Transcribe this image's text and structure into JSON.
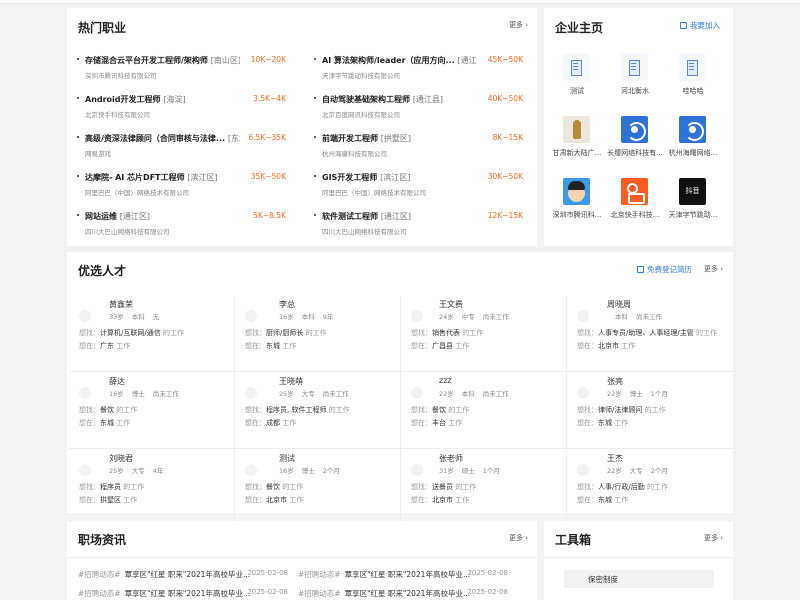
{
  "hot_jobs": {
    "title": "热门职业",
    "more": "更多",
    "items": [
      {
        "title": "存储混合云平台开发工程师/架构师",
        "area": "[南山区]",
        "salary": "10K~20K",
        "company": "深圳市腾讯科技有限公司"
      },
      {
        "title": "AI 算法架构师/leader（应用方向...",
        "area": "[通江县]",
        "salary": "45K~50K",
        "company": "天津字节跳动科技有限公司"
      },
      {
        "title": "Android开发工程师",
        "area": "[海淀]",
        "salary": "3.5K~4K",
        "company": "北京快手科技有限公司"
      },
      {
        "title": "自动驾驶基础架构工程师",
        "area": "[通江县]",
        "salary": "40K~50K",
        "company": "北京百度网讯科技有限公司"
      },
      {
        "title": "高级/资深法律顾问（合同审核与法律...",
        "area": "[东城]",
        "salary": "6.5K~35K",
        "company": "网易游戏"
      },
      {
        "title": "前端开发工程师",
        "area": "[拱墅区]",
        "salary": "8K~15K",
        "company": "杭州海康科技有限公司"
      },
      {
        "title": "达摩院- AI 芯片DFT工程师",
        "area": "[滨江区]",
        "salary": "35K~50K",
        "company": "阿里巴巴（中国）网络技术有限公司"
      },
      {
        "title": "GIS开发工程师",
        "area": "[滨江区]",
        "salary": "30K~50K",
        "company": "阿里巴巴（中国）网络技术有限公司"
      },
      {
        "title": "网站运维",
        "area": "[通江区]",
        "salary": "5K~8.5K",
        "company": "四川大巴山网络科技有限公司"
      },
      {
        "title": "软件测试工程师",
        "area": "[通江区]",
        "salary": "12K~15K",
        "company": "四川大巴山网络科技有限公司"
      }
    ]
  },
  "companies": {
    "title": "企业主页",
    "join": "我要加入",
    "items": [
      {
        "name": "测试",
        "logo": "building-icon"
      },
      {
        "name": "河北衡水",
        "logo": "building-icon"
      },
      {
        "name": "哇哈哈",
        "logo": "building-icon"
      },
      {
        "name": "甘肃新大陆广...",
        "logo": "sculpture-logo"
      },
      {
        "name": "长缨网络科技有...",
        "logo": "bird-logo"
      },
      {
        "name": "杭州海曙网络...",
        "logo": "bird-logo"
      },
      {
        "name": "深圳市腾讯科...",
        "logo": "qq-face-logo"
      },
      {
        "name": "北京快手科技...",
        "logo": "kuaishou-logo"
      },
      {
        "name": "天津字节跳动...",
        "logo": "douyin-logo",
        "logo_text": "抖音"
      }
    ]
  },
  "talents": {
    "title": "优选人才",
    "register": "免费登记简历",
    "more": "更多",
    "want_label": "想找：",
    "place_label": "想在：",
    "work_suffix": "的工作",
    "work_word": "工作",
    "items": [
      {
        "name": "黄鑫荣",
        "age": "33岁",
        "edu": "本科",
        "exp": "无",
        "want": "计算机/互联网/通信",
        "place": "广东"
      },
      {
        "name": "李总",
        "age": "16岁",
        "edu": "本科",
        "exp": "9年",
        "want": "厨师/厨师长",
        "place": "东城"
      },
      {
        "name": "王文费",
        "age": "24岁",
        "edu": "中专",
        "exp": "尚未工作",
        "want": "销售代表",
        "place": "广昌县"
      },
      {
        "name": "周晓周",
        "age": "",
        "edu": "本科",
        "exp": "尚未工作",
        "want": "人事专员/助理、人事经理/主管",
        "place": "北京市"
      },
      {
        "name": "薛达",
        "age": "16岁",
        "edu": "博士",
        "exp": "尚未工作",
        "want": "餐饮",
        "place": "东城"
      },
      {
        "name": "王晓萌",
        "age": "25岁",
        "edu": "大专",
        "exp": "尚未工作",
        "want": "程序员, 软件工程师",
        "place": "成都"
      },
      {
        "name": "zzz",
        "age": "22岁",
        "edu": "本科",
        "exp": "尚未工作",
        "want": "餐饮",
        "place": "丰台"
      },
      {
        "name": "张亮",
        "age": "22岁",
        "edu": "博士",
        "exp": "1个月",
        "want": "律师/法律顾问",
        "place": "东城"
      },
      {
        "name": "刘晓君",
        "age": "25岁",
        "edu": "大专",
        "exp": "4年",
        "want": "程序员",
        "place": "拱墅区"
      },
      {
        "name": "测试",
        "age": "16岁",
        "edu": "博士",
        "exp": "2个月",
        "want": "餐饮",
        "place": "北京市"
      },
      {
        "name": "张老师",
        "age": "31岁",
        "edu": "硕士",
        "exp": "1个月",
        "want": "送餐员",
        "place": "北京市"
      },
      {
        "name": "王杰",
        "age": "22岁",
        "edu": "大专",
        "exp": "2个月",
        "want": "人事/行政/后勤",
        "place": "东城"
      }
    ]
  },
  "news": {
    "title": "职场资讯",
    "more": "更多",
    "items": [
      {
        "tag": "#招聘动态#",
        "text": "覃享区\"红星 职来\"2021年高校毕业...",
        "date": "2025-02-08"
      },
      {
        "tag": "#招聘动态#",
        "text": "覃享区\"红星 职来\"2021年高校毕业...",
        "date": "2025-02-08"
      },
      {
        "tag": "#招聘动态#",
        "text": "覃享区\"红星 职来\"2021年高校毕业...",
        "date": "2025-02-08"
      },
      {
        "tag": "#招聘动态#",
        "text": "覃享区\"红星 职来\"2021年高校毕业...",
        "date": "2025-02-08"
      }
    ]
  },
  "toolbox": {
    "title": "工具箱",
    "more": "更多",
    "items": [
      "保密制度"
    ]
  },
  "colors": {
    "accent": "#2d7ee0",
    "salary": "#ff6a1a"
  }
}
